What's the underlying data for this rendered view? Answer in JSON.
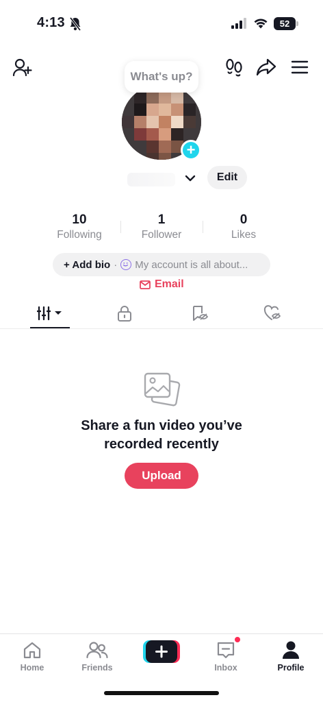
{
  "status_bar": {
    "time": "4:13",
    "battery": "52"
  },
  "bubble": {
    "text": "What's up?"
  },
  "profile": {
    "edit_label": "Edit"
  },
  "stats": [
    {
      "value": "10",
      "label": "Following"
    },
    {
      "value": "1",
      "label": "Follower"
    },
    {
      "value": "0",
      "label": "Likes"
    }
  ],
  "bio": {
    "add_label": "+ Add bio",
    "separator": "·",
    "placeholder": "My account is all about..."
  },
  "email_label": "Email",
  "empty_state": {
    "title": "Share a fun video you’ve recorded recently",
    "button": "Upload"
  },
  "nav": {
    "home": "Home",
    "friends": "Friends",
    "create": "+",
    "inbox": "Inbox",
    "profile": "Profile"
  },
  "colors": {
    "accent": "#e8425d",
    "create_cyan": "#20d5ec",
    "text": "#161823",
    "muted": "#8a8b91"
  },
  "icons": [
    "add-friend-icon",
    "footprints-icon",
    "share-icon",
    "menu-icon",
    "chevron-down-icon",
    "grid-icon",
    "lock-icon",
    "bookmark-icon",
    "heart-icon",
    "photos-icon",
    "home-icon",
    "friends-icon",
    "inbox-icon",
    "profile-icon",
    "mute-bell-icon"
  ]
}
